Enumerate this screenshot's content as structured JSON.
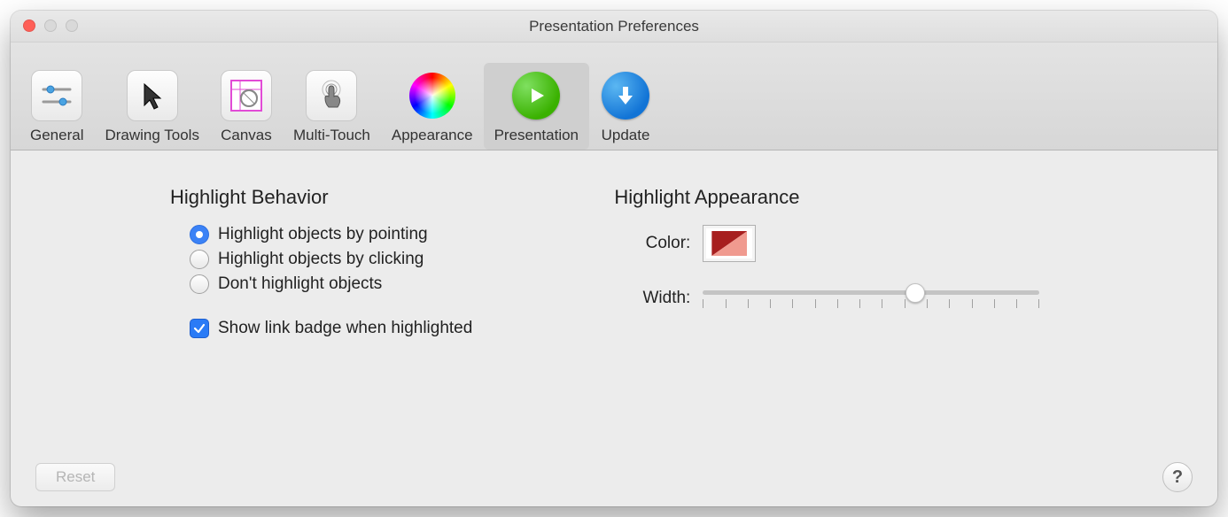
{
  "window": {
    "title": "Presentation Preferences"
  },
  "toolbar": {
    "items": [
      {
        "label": "General"
      },
      {
        "label": "Drawing Tools"
      },
      {
        "label": "Canvas"
      },
      {
        "label": "Multi-Touch"
      },
      {
        "label": "Appearance"
      },
      {
        "label": "Presentation"
      },
      {
        "label": "Update"
      }
    ],
    "selected_index": 5
  },
  "behavior": {
    "title": "Highlight Behavior",
    "options": [
      "Highlight objects by pointing",
      "Highlight objects by clicking",
      "Don't highlight objects"
    ],
    "selected_index": 0,
    "checkbox_label": "Show link badge when highlighted",
    "checkbox_checked": true
  },
  "appearance": {
    "title": "Highlight Appearance",
    "color_label": "Color:",
    "width_label": "Width:",
    "color_value": [
      "#a71f1f",
      "#f09a8f"
    ],
    "width_percent": 63
  },
  "footer": {
    "reset_label": "Reset",
    "help_label": "?"
  }
}
